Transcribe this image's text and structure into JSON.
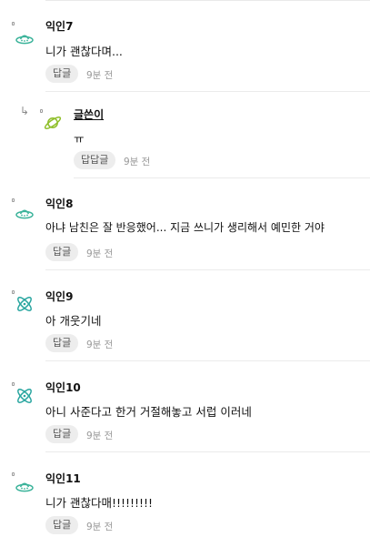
{
  "colors": {
    "ufo": "#3bb39a",
    "atom": "#2aa6a0",
    "planet": "#8fbf2a",
    "button_bg": "#ededed"
  },
  "comments": [
    {
      "author": "익인7",
      "text": "니가 괜찮다며...",
      "reply_label": "답글",
      "time": "9분 전",
      "icon": "ufo-icon"
    },
    {
      "author": "글쓴이",
      "text": "ㅠ",
      "reply_label": "답답글",
      "time": "9분 전",
      "icon": "planet-icon",
      "is_reply": true,
      "reply_arrow": "↳"
    },
    {
      "author": "익인8",
      "text": "아냐 남친은 잘 반응했어... 지금 쓰니가 생리해서 예민한 거야",
      "reply_label": "답글",
      "time": "9분 전",
      "icon": "ufo-icon"
    },
    {
      "author": "익인9",
      "text": "아 개웃기네",
      "reply_label": "답글",
      "time": "9분 전",
      "icon": "atom-icon"
    },
    {
      "author": "익인10",
      "text": "아니 사준다고 한거 거절해놓고 서럽 이러네",
      "reply_label": "답글",
      "time": "9분 전",
      "icon": "atom-icon"
    },
    {
      "author": "익인11",
      "text": "니가 괜찮다매!!!!!!!!!",
      "reply_label": "답글",
      "time": "9분 전",
      "icon": "ufo-icon"
    }
  ]
}
